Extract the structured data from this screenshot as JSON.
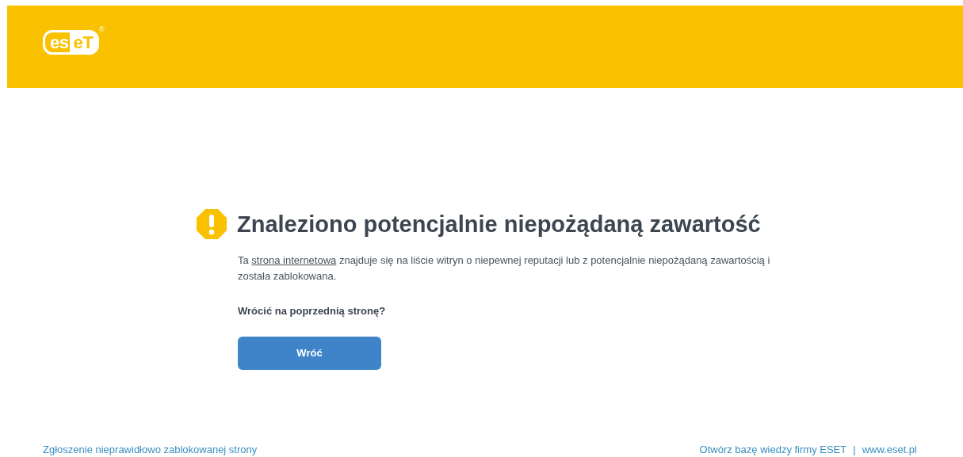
{
  "header": {
    "logo": {
      "left": "es",
      "right": "eT",
      "mark": "®"
    }
  },
  "alert": {
    "title": "Znaleziono potencjalnie niepożądaną zawartość",
    "message": {
      "before": "Ta ",
      "link": "strona internetowa",
      "after": " znajduje się na liście witryn o niepewnej reputacji lub z potencjalnie niepożądaną zawartością i została zablokowana."
    },
    "question": "Wrócić na poprzednią stronę?",
    "button": "Wróć"
  },
  "footer": {
    "left_link": "Zgłoszenie nieprawidłowo zablokowanej strony",
    "right_links": [
      "Otwórz bazę wiedzy firmy ESET",
      "www.eset.pl"
    ],
    "separator": "|"
  }
}
